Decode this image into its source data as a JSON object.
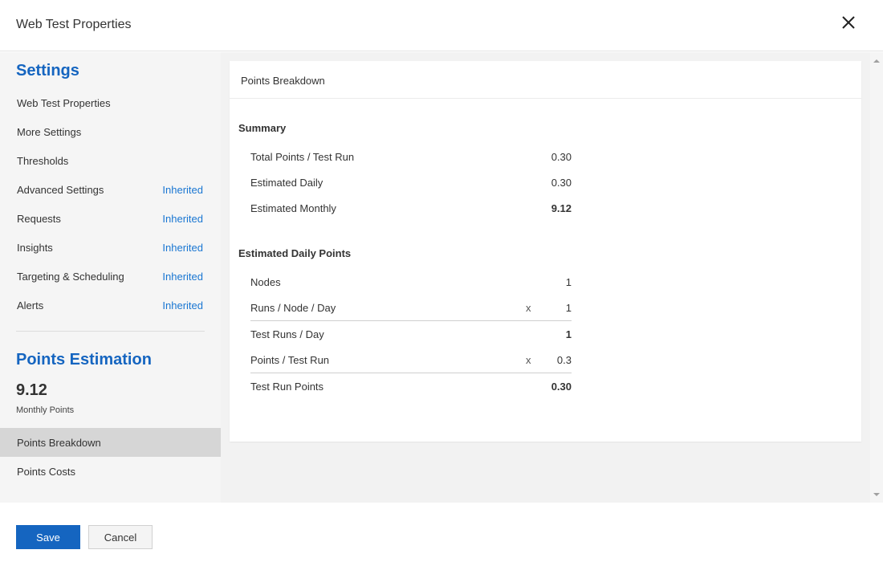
{
  "header": {
    "title": "Web Test Properties"
  },
  "sidebar": {
    "settings_heading": "Settings",
    "items": [
      {
        "label": "Web Test Properties",
        "badge": ""
      },
      {
        "label": "More Settings",
        "badge": ""
      },
      {
        "label": "Thresholds",
        "badge": ""
      },
      {
        "label": "Advanced Settings",
        "badge": "Inherited"
      },
      {
        "label": "Requests",
        "badge": "Inherited"
      },
      {
        "label": "Insights",
        "badge": "Inherited"
      },
      {
        "label": "Targeting & Scheduling",
        "badge": "Inherited"
      },
      {
        "label": "Alerts",
        "badge": "Inherited"
      }
    ],
    "points_heading": "Points Estimation",
    "monthly_points_value": "9.12",
    "monthly_points_label": "Monthly Points",
    "points_items": [
      {
        "label": "Points Breakdown",
        "active": true
      },
      {
        "label": "Points Costs",
        "active": false
      }
    ]
  },
  "card": {
    "title": "Points Breakdown",
    "summary": {
      "heading": "Summary",
      "rows": [
        {
          "label": "Total Points / Test Run",
          "value": "0.30"
        },
        {
          "label": "Estimated Daily",
          "value": "0.30"
        },
        {
          "label": "Estimated Monthly",
          "value": "9.12"
        }
      ]
    },
    "daily": {
      "heading": "Estimated Daily Points",
      "rows": [
        {
          "label": "Nodes",
          "op": "",
          "value": "1"
        },
        {
          "label": "Runs / Node / Day",
          "op": "x",
          "value": "1"
        },
        {
          "label": "Test Runs / Day",
          "op": "",
          "value": "1"
        },
        {
          "label": "Points / Test Run",
          "op": "x",
          "value": "0.3"
        },
        {
          "label": "Test Run Points",
          "op": "",
          "value": "0.30"
        }
      ]
    }
  },
  "footer": {
    "save_label": "Save",
    "cancel_label": "Cancel"
  },
  "colors": {
    "accent": "#1565c0",
    "link": "#1976d2",
    "active_nav": "#d6d6d6"
  }
}
